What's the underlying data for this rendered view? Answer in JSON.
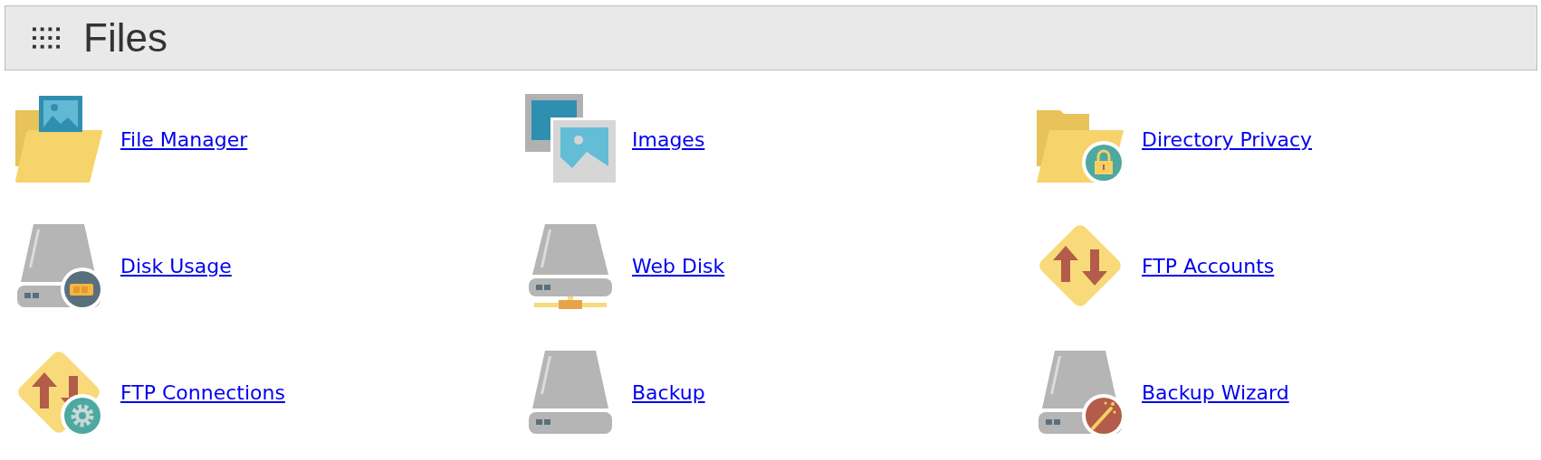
{
  "section": {
    "title": "Files"
  },
  "items": [
    {
      "label": "File Manager",
      "kind": "folder-image"
    },
    {
      "label": "Images",
      "kind": "images"
    },
    {
      "label": "Directory Privacy",
      "kind": "folder-lock"
    },
    {
      "label": "Disk Usage",
      "kind": "disk-usage"
    },
    {
      "label": "Web Disk",
      "kind": "web-disk"
    },
    {
      "label": "FTP Accounts",
      "kind": "ftp"
    },
    {
      "label": "FTP Connections",
      "kind": "ftp-gear"
    },
    {
      "label": "Backup",
      "kind": "disk"
    },
    {
      "label": "Backup Wizard",
      "kind": "disk-wand"
    }
  ]
}
